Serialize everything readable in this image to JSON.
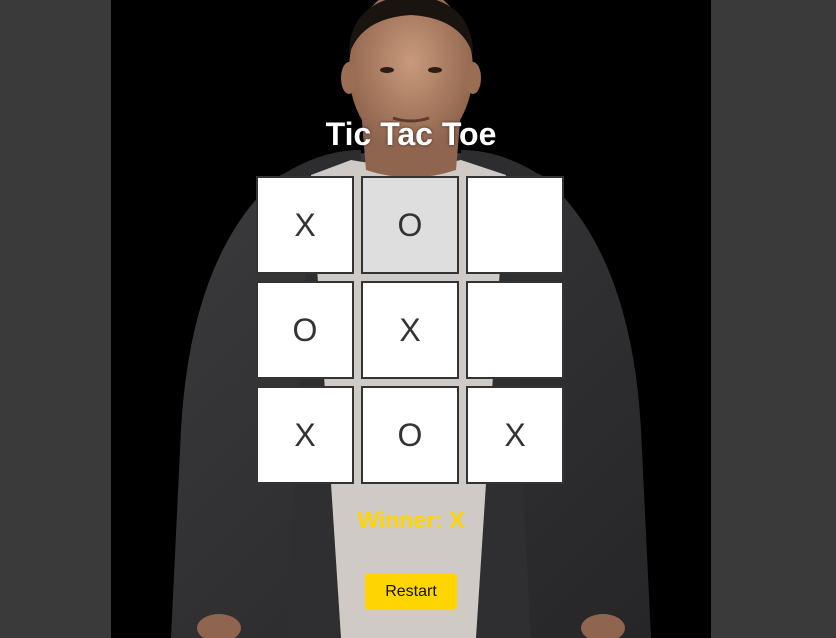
{
  "game": {
    "title": "Tic Tac Toe",
    "status": "Winner: X",
    "restart_label": "Restart",
    "board": [
      {
        "mark": "X",
        "highlighted": false
      },
      {
        "mark": "O",
        "highlighted": true
      },
      {
        "mark": "",
        "highlighted": false
      },
      {
        "mark": "O",
        "highlighted": false
      },
      {
        "mark": "X",
        "highlighted": false
      },
      {
        "mark": "",
        "highlighted": false
      },
      {
        "mark": "X",
        "highlighted": false
      },
      {
        "mark": "O",
        "highlighted": false
      },
      {
        "mark": "X",
        "highlighted": false
      }
    ]
  },
  "colors": {
    "page_background": "#3a3a3a",
    "stage_background": "#000000",
    "cell_background": "#ffffff",
    "cell_highlight": "#dedede",
    "cell_border": "#333333",
    "accent": "#ffd500",
    "title": "#ffffff"
  }
}
